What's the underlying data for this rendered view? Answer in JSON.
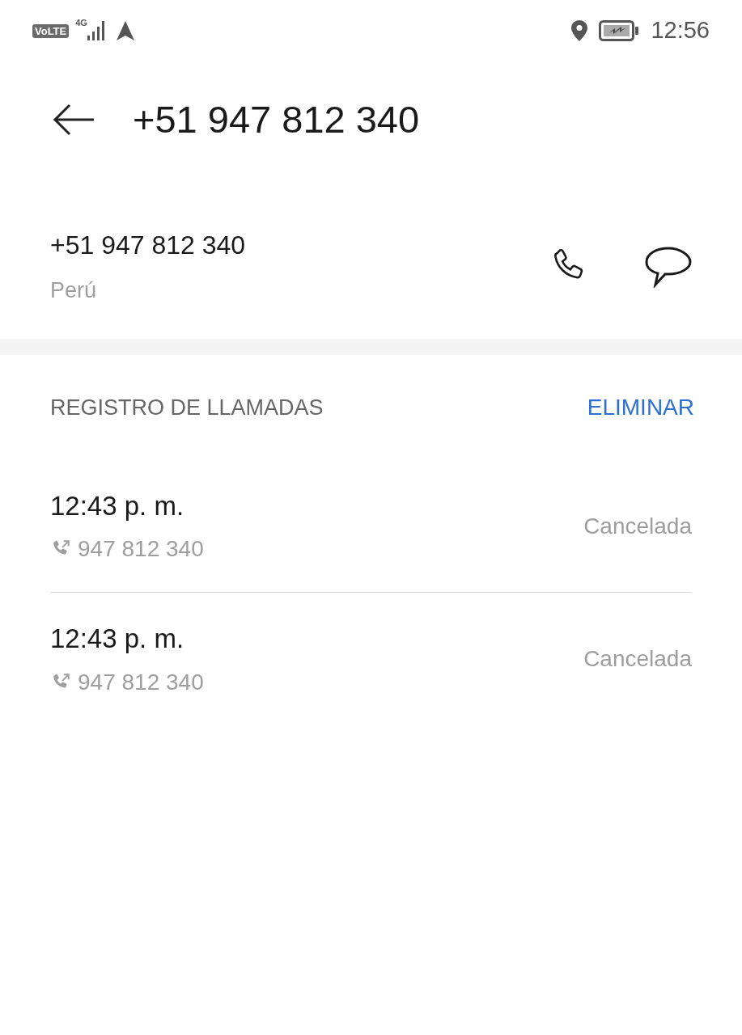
{
  "status_bar": {
    "volte": "VoLTE",
    "network": "4G",
    "time": "12:56"
  },
  "header": {
    "title": "+51 947 812 340"
  },
  "contact": {
    "number": "+51 947 812 340",
    "country": "Perú"
  },
  "call_log": {
    "title": "REGISTRO DE LLAMADAS",
    "action": "ELIMINAR",
    "entries": [
      {
        "time": "12:43 p. m.",
        "number": "947 812 340",
        "status": "Cancelada",
        "kind": "outgoing"
      },
      {
        "time": "12:43 p. m.",
        "number": "947 812 340",
        "status": "Cancelada",
        "kind": "outgoing"
      }
    ]
  }
}
